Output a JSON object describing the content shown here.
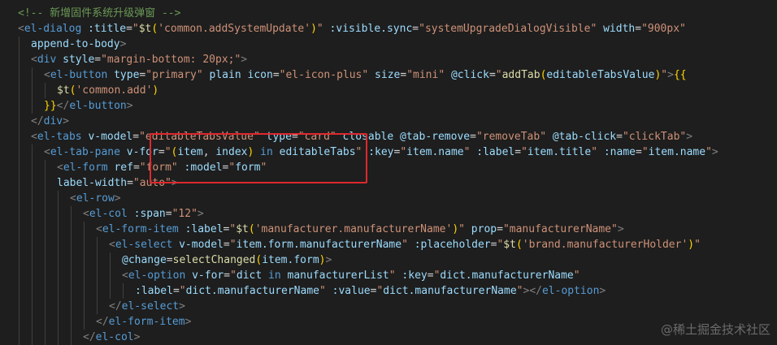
{
  "colors": {
    "background": "#1e1e1e",
    "comment": "#6a9955",
    "tag": "#569cd6",
    "attribute": "#9cdcfe",
    "string": "#ce9178",
    "text": "#d4d4d4",
    "function": "#dcdcaa",
    "bracket": "#ffd700",
    "punct": "#808080",
    "highlight_border": "#e0282e"
  },
  "code_lines": [
    {
      "indent": 0,
      "tokens": [
        [
          "<!-- 新增固件系统升级弹窗 -->",
          "comment"
        ]
      ]
    },
    {
      "indent": 0,
      "tokens": [
        [
          "<",
          "punct"
        ],
        [
          "el-dialog",
          "tag"
        ],
        [
          " :title",
          "attribute"
        ],
        [
          "=",
          "text"
        ],
        [
          "\"",
          "string"
        ],
        [
          "$t",
          "function"
        ],
        [
          "(",
          "bracket"
        ],
        [
          "'common.addSystemUpdate'",
          "string"
        ],
        [
          ")",
          "bracket"
        ],
        [
          "\"",
          "string"
        ],
        [
          " :visible.sync",
          "attribute"
        ],
        [
          "=",
          "text"
        ],
        [
          "\"systemUpgradeDialogVisible\"",
          "string"
        ],
        [
          " width",
          "attribute"
        ],
        [
          "=",
          "text"
        ],
        [
          "\"900px\"",
          "string"
        ]
      ]
    },
    {
      "indent": 1,
      "tokens": [
        [
          "append-to-body",
          "attribute"
        ],
        [
          ">",
          "punct"
        ]
      ]
    },
    {
      "indent": 1,
      "tokens": [
        [
          "<",
          "punct"
        ],
        [
          "div",
          "tag"
        ],
        [
          " style",
          "attribute"
        ],
        [
          "=",
          "text"
        ],
        [
          "\"margin-bottom: 20px;\"",
          "string"
        ],
        [
          ">",
          "punct"
        ]
      ]
    },
    {
      "indent": 2,
      "tokens": [
        [
          "<",
          "punct"
        ],
        [
          "el-button",
          "tag"
        ],
        [
          " type",
          "attribute"
        ],
        [
          "=",
          "text"
        ],
        [
          "\"primary\"",
          "string"
        ],
        [
          " plain",
          "attribute"
        ],
        [
          " icon",
          "attribute"
        ],
        [
          "=",
          "text"
        ],
        [
          "\"el-icon-plus\"",
          "string"
        ],
        [
          " size",
          "attribute"
        ],
        [
          "=",
          "text"
        ],
        [
          "\"mini\"",
          "string"
        ],
        [
          " @click",
          "attribute"
        ],
        [
          "=",
          "text"
        ],
        [
          "\"",
          "string"
        ],
        [
          "addTab",
          "function"
        ],
        [
          "(",
          "bracket"
        ],
        [
          "editableTabsValue",
          "attribute"
        ],
        [
          ")",
          "bracket"
        ],
        [
          "\"",
          "string"
        ],
        [
          ">",
          "punct"
        ],
        [
          "{{",
          "bracket"
        ]
      ]
    },
    {
      "indent": 3,
      "tokens": [
        [
          "$t",
          "function"
        ],
        [
          "(",
          "bracket"
        ],
        [
          "'common.add'",
          "string"
        ],
        [
          ")",
          "bracket"
        ]
      ]
    },
    {
      "indent": 2,
      "tokens": [
        [
          "}}",
          "bracket"
        ],
        [
          "</",
          "punct"
        ],
        [
          "el-button",
          "tag"
        ],
        [
          ">",
          "punct"
        ]
      ]
    },
    {
      "indent": 1,
      "tokens": [
        [
          "</",
          "punct"
        ],
        [
          "div",
          "tag"
        ],
        [
          ">",
          "punct"
        ]
      ]
    },
    {
      "indent": 1,
      "tokens": [
        [
          "<",
          "punct"
        ],
        [
          "el-tabs",
          "tag"
        ],
        [
          " v-model",
          "attribute"
        ],
        [
          "=",
          "text"
        ],
        [
          "\"editableTabsValue\"",
          "string"
        ],
        [
          " type",
          "attribute"
        ],
        [
          "=",
          "text"
        ],
        [
          "\"card\"",
          "string"
        ],
        [
          " closable",
          "attribute"
        ],
        [
          " @tab-remove",
          "attribute"
        ],
        [
          "=",
          "text"
        ],
        [
          "\"removeTab\"",
          "string"
        ],
        [
          " @tab-click",
          "attribute"
        ],
        [
          "=",
          "text"
        ],
        [
          "\"clickTab\"",
          "string"
        ],
        [
          ">",
          "punct"
        ]
      ]
    },
    {
      "indent": 2,
      "tokens": [
        [
          "<",
          "punct"
        ],
        [
          "el-tab-pane",
          "tag"
        ],
        [
          " v-for",
          "attribute"
        ],
        [
          "=",
          "text"
        ],
        [
          "\"",
          "string"
        ],
        [
          "(",
          "bracket"
        ],
        [
          "item",
          "attribute"
        ],
        [
          ", ",
          "text"
        ],
        [
          "index",
          "attribute"
        ],
        [
          ")",
          "bracket"
        ],
        [
          " in ",
          "tag"
        ],
        [
          "editableTabs",
          "attribute"
        ],
        [
          "\"",
          "string"
        ],
        [
          " :key",
          "attribute"
        ],
        [
          "=",
          "text"
        ],
        [
          "\"",
          "string"
        ],
        [
          "item.name",
          "attribute"
        ],
        [
          "\"",
          "string"
        ],
        [
          " :label",
          "attribute"
        ],
        [
          "=",
          "text"
        ],
        [
          "\"",
          "string"
        ],
        [
          "item.title",
          "attribute"
        ],
        [
          "\"",
          "string"
        ],
        [
          " :name",
          "attribute"
        ],
        [
          "=",
          "text"
        ],
        [
          "\"",
          "string"
        ],
        [
          "item.name",
          "attribute"
        ],
        [
          "\"",
          "string"
        ],
        [
          ">",
          "punct"
        ]
      ]
    },
    {
      "indent": 3,
      "tokens": [
        [
          "<",
          "punct"
        ],
        [
          "el-form",
          "tag"
        ],
        [
          " ref",
          "attribute"
        ],
        [
          "=",
          "text"
        ],
        [
          "\"form\"",
          "string"
        ],
        [
          " :model",
          "attribute"
        ],
        [
          "=",
          "text"
        ],
        [
          "\"",
          "string"
        ],
        [
          "form",
          "attribute"
        ],
        [
          "\"",
          "string"
        ]
      ]
    },
    {
      "indent": 3,
      "tokens": [
        [
          "label-width",
          "attribute"
        ],
        [
          "=",
          "text"
        ],
        [
          "\"auto\"",
          "string"
        ],
        [
          ">",
          "punct"
        ]
      ]
    },
    {
      "indent": 4,
      "tokens": [
        [
          "<",
          "punct"
        ],
        [
          "el-row",
          "tag"
        ],
        [
          ">",
          "punct"
        ]
      ]
    },
    {
      "indent": 5,
      "tokens": [
        [
          "<",
          "punct"
        ],
        [
          "el-col",
          "tag"
        ],
        [
          " :span",
          "attribute"
        ],
        [
          "=",
          "text"
        ],
        [
          "\"12\"",
          "string"
        ],
        [
          ">",
          "punct"
        ]
      ]
    },
    {
      "indent": 6,
      "tokens": [
        [
          "<",
          "punct"
        ],
        [
          "el-form-item",
          "tag"
        ],
        [
          " :label",
          "attribute"
        ],
        [
          "=",
          "text"
        ],
        [
          "\"",
          "string"
        ],
        [
          "$t",
          "function"
        ],
        [
          "(",
          "bracket"
        ],
        [
          "'manufacturer.manufacturerName'",
          "string"
        ],
        [
          ")",
          "bracket"
        ],
        [
          "\"",
          "string"
        ],
        [
          " prop",
          "attribute"
        ],
        [
          "=",
          "text"
        ],
        [
          "\"manufacturerName\"",
          "string"
        ],
        [
          ">",
          "punct"
        ]
      ]
    },
    {
      "indent": 7,
      "tokens": [
        [
          "<",
          "punct"
        ],
        [
          "el-select",
          "tag"
        ],
        [
          " v-model",
          "attribute"
        ],
        [
          "=",
          "text"
        ],
        [
          "\"",
          "string"
        ],
        [
          "item.form.manufacturerName",
          "attribute"
        ],
        [
          "\"",
          "string"
        ],
        [
          " :placeholder",
          "attribute"
        ],
        [
          "=",
          "text"
        ],
        [
          "\"",
          "string"
        ],
        [
          "$t",
          "function"
        ],
        [
          "(",
          "bracket"
        ],
        [
          "'brand.manufacturerHolder'",
          "string"
        ],
        [
          ")",
          "bracket"
        ],
        [
          "\"",
          "string"
        ]
      ]
    },
    {
      "indent": 8,
      "tokens": [
        [
          "@change",
          "attribute"
        ],
        [
          "=",
          "text"
        ],
        [
          "selectChanged",
          "function"
        ],
        [
          "(",
          "bracket"
        ],
        [
          "item.form",
          "attribute"
        ],
        [
          ")",
          "bracket"
        ],
        [
          ">",
          "punct"
        ]
      ]
    },
    {
      "indent": 8,
      "tokens": [
        [
          "<",
          "punct"
        ],
        [
          "el-option",
          "tag"
        ],
        [
          " v-for",
          "attribute"
        ],
        [
          "=",
          "text"
        ],
        [
          "\"",
          "string"
        ],
        [
          "dict",
          "attribute"
        ],
        [
          " in ",
          "tag"
        ],
        [
          "manufacturerList",
          "attribute"
        ],
        [
          "\"",
          "string"
        ],
        [
          " :key",
          "attribute"
        ],
        [
          "=",
          "text"
        ],
        [
          "\"",
          "string"
        ],
        [
          "dict.manufacturerName",
          "attribute"
        ],
        [
          "\"",
          "string"
        ]
      ]
    },
    {
      "indent": 9,
      "tokens": [
        [
          ":label",
          "attribute"
        ],
        [
          "=",
          "text"
        ],
        [
          "\"",
          "string"
        ],
        [
          "dict.manufacturerName",
          "attribute"
        ],
        [
          "\"",
          "string"
        ],
        [
          " :value",
          "attribute"
        ],
        [
          "=",
          "text"
        ],
        [
          "\"",
          "string"
        ],
        [
          "dict.manufacturerName",
          "attribute"
        ],
        [
          "\"",
          "string"
        ],
        [
          ">",
          "punct"
        ],
        [
          "</",
          "punct"
        ],
        [
          "el-option",
          "tag"
        ],
        [
          ">",
          "punct"
        ]
      ]
    },
    {
      "indent": 7,
      "tokens": [
        [
          "</",
          "punct"
        ],
        [
          "el-select",
          "tag"
        ],
        [
          ">",
          "punct"
        ]
      ]
    },
    {
      "indent": 6,
      "tokens": [
        [
          "</",
          "punct"
        ],
        [
          "el-form-item",
          "tag"
        ],
        [
          ">",
          "punct"
        ]
      ]
    },
    {
      "indent": 5,
      "tokens": [
        [
          "</",
          "punct"
        ],
        [
          "el-col",
          "tag"
        ],
        [
          ">",
          "punct"
        ]
      ]
    }
  ],
  "watermark": "@稀土掘金技术社区"
}
